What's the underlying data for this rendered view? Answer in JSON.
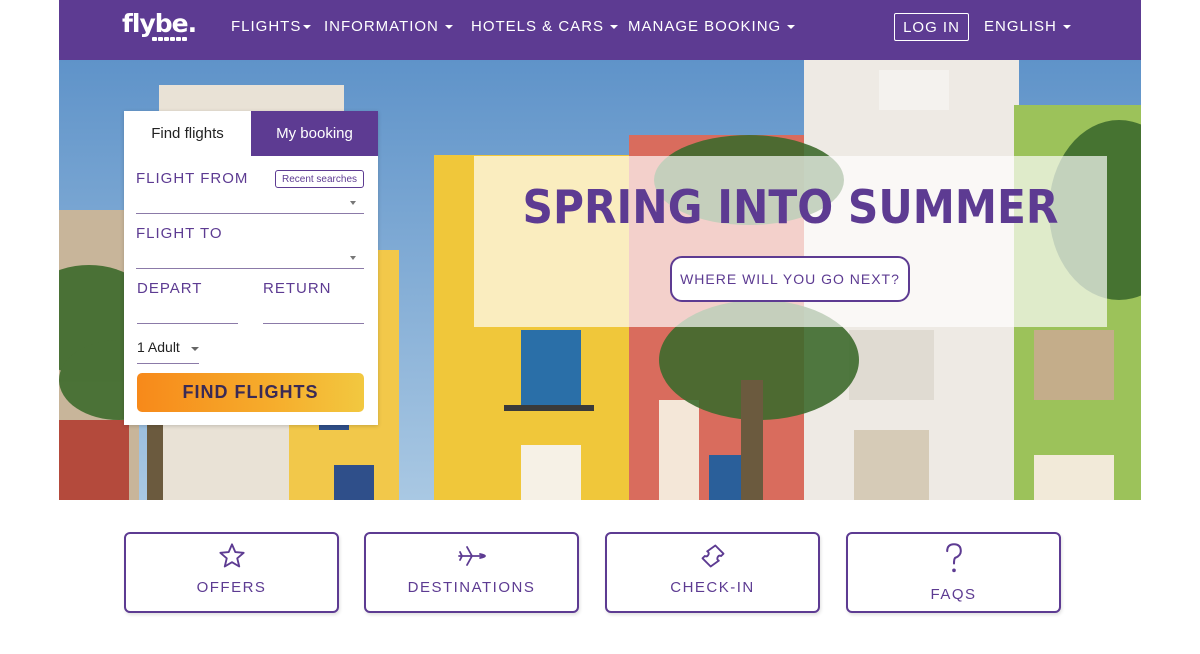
{
  "nav": {
    "logo": "flybe.",
    "items": [
      {
        "label": "FLIGHTS"
      },
      {
        "label": "INFORMATION"
      },
      {
        "label": "HOTELS & CARS"
      },
      {
        "label": "MANAGE BOOKING"
      }
    ],
    "login": "LOG IN",
    "language": "ENGLISH"
  },
  "hero": {
    "title": "SPRING INTO SUMMER",
    "cta": "WHERE WILL YOU GO NEXT?"
  },
  "search": {
    "tabs": {
      "find": "Find flights",
      "booking": "My booking"
    },
    "from_label": "FLIGHT FROM",
    "recent_searches": "Recent searches",
    "to_label": "FLIGHT TO",
    "depart_label": "DEPART",
    "return_label": "RETURN",
    "passengers": "1 Adult",
    "submit": "FIND FLIGHTS"
  },
  "quick_links": [
    {
      "label": "OFFERS",
      "icon": "star-icon"
    },
    {
      "label": "DESTINATIONS",
      "icon": "plane-icon"
    },
    {
      "label": "CHECK-IN",
      "icon": "ticket-icon"
    },
    {
      "label": "FAQS",
      "icon": "question-icon"
    }
  ],
  "colors": {
    "brand": "#5d3b92",
    "cta_orange": "#f7891a",
    "cta_yellow": "#f2c840"
  }
}
